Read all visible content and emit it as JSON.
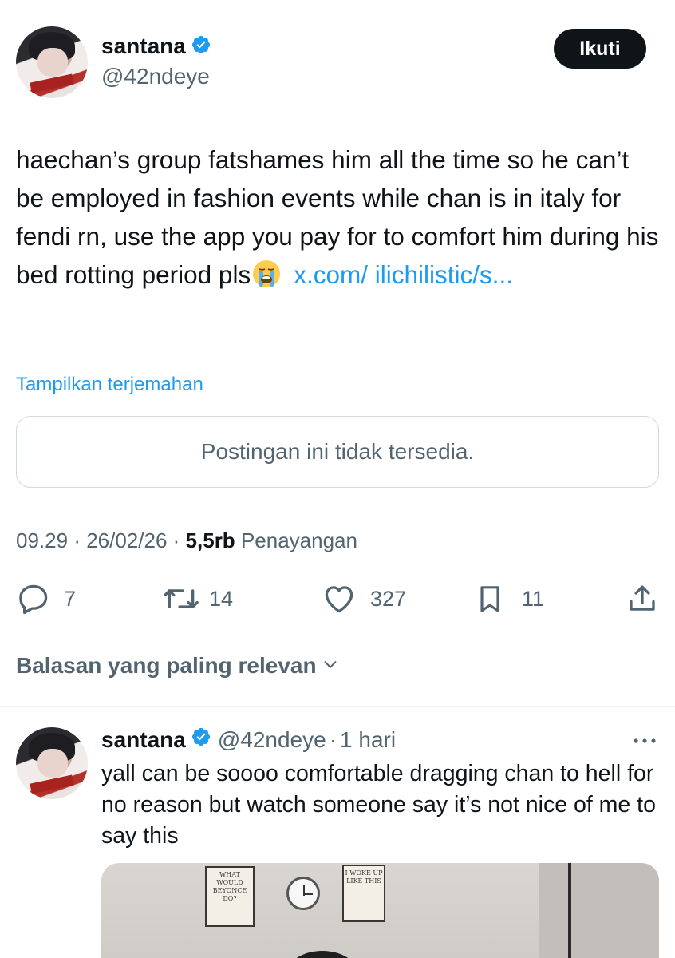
{
  "post": {
    "display_name": "santana",
    "handle": "@42ndeye",
    "follow_label": "Ikuti",
    "text_parts": {
      "line1": "haechan’s group fatshames him all the time so he can’t be employed in fashion events while chan is in italy for fendi rn, use the app you pay for to comfort him during his bed rotting period pls",
      "emoji_name": "loudly-crying-face-emoji",
      "link": "x.com/ ilichilistic/s..."
    },
    "translate_label": "Tampilkan terjemahan",
    "unavailable_text": "Postingan ini tidak tersedia.",
    "time": "09.29",
    "date": "26/02/26",
    "views_count": "5,5rb",
    "views_label": "Penayangan",
    "stats": {
      "replies": "7",
      "reposts": "14",
      "likes": "327",
      "bookmarks": "11"
    }
  },
  "replies_sort_label": "Balasan yang paling relevan",
  "reply": {
    "display_name": "santana",
    "handle": "@42ndeye",
    "time_ago": "1 hari",
    "text": "yall can be soooo comfortable dragging chan to hell for no reason but watch someone say it’s not nice of me to say this",
    "media": {
      "poster_left": "WHAT WOULD BEYONCE DO?",
      "poster_right": "I WOKE UP LIKE THIS"
    }
  },
  "colors": {
    "text": "#0f1419",
    "secondary": "#536471",
    "link": "#1d9bf0",
    "verified": "#1d9bf0",
    "border": "#cfd9de"
  }
}
